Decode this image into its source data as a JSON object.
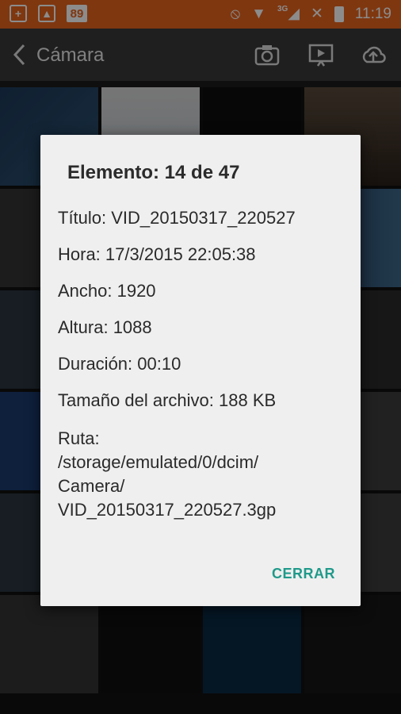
{
  "status_bar": {
    "notification_badge": "89",
    "network_label": "3G",
    "time": "11:19",
    "icons": [
      "plus-notification-icon",
      "image-notification-icon",
      "number-badge-icon",
      "do-not-disturb-icon",
      "wifi-icon",
      "signal-icon",
      "no-sim-icon",
      "battery-icon"
    ]
  },
  "app_bar": {
    "title": "Cámara",
    "icons": [
      "back-icon",
      "camera-icon",
      "slideshow-icon",
      "cloud-upload-icon"
    ]
  },
  "dialog": {
    "title": "Elemento: 14 de 47",
    "title_line": "Título: VID_20150317_220527",
    "time_line": "Hora: 17/3/2015 22:05:38",
    "width_line": "Ancho: 1920",
    "height_line": "Altura: 1088",
    "duration_line": "Duración: 00:10",
    "size_line": "Tamaño del archivo: 188 KB",
    "path_label": "Ruta:",
    "path_line1": "/storage/emulated/0/dcim/",
    "path_line2": "Camera/",
    "path_line3": "VID_20150317_220527.3gp",
    "close_label": "CERRAR"
  },
  "colors": {
    "status_bar": "#e8641e",
    "app_bar": "#3a3a3a",
    "dialog_bg": "#efefef",
    "accent": "#1f9a8a"
  }
}
